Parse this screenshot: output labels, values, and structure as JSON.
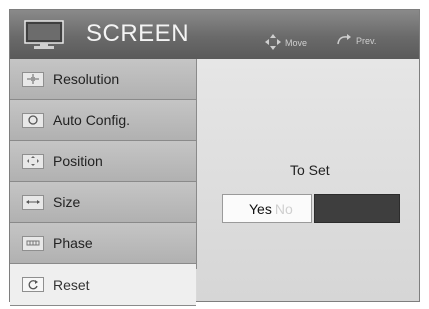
{
  "header": {
    "title": "SCREEN",
    "icon": "monitor-icon",
    "hints": {
      "move_label": "Move",
      "prev_label": "Prev."
    }
  },
  "menu": {
    "items": [
      {
        "label": "Resolution",
        "icon": "resolution-icon"
      },
      {
        "label": "Auto Config.",
        "icon": "auto-config-icon"
      },
      {
        "label": "Position",
        "icon": "position-icon"
      },
      {
        "label": "Size",
        "icon": "size-icon"
      },
      {
        "label": "Phase",
        "icon": "phase-icon"
      },
      {
        "label": "Reset",
        "icon": "reset-icon"
      }
    ],
    "selected": "Reset"
  },
  "panel": {
    "prompt": "To Set",
    "yes_label": "Yes",
    "no_label": "No"
  },
  "colors": {
    "header_bg": "#6a6a6a",
    "menu_bg": "#b9b9b9",
    "selected_bg": "#efefef",
    "no_button_bg": "#3e3e3e"
  }
}
